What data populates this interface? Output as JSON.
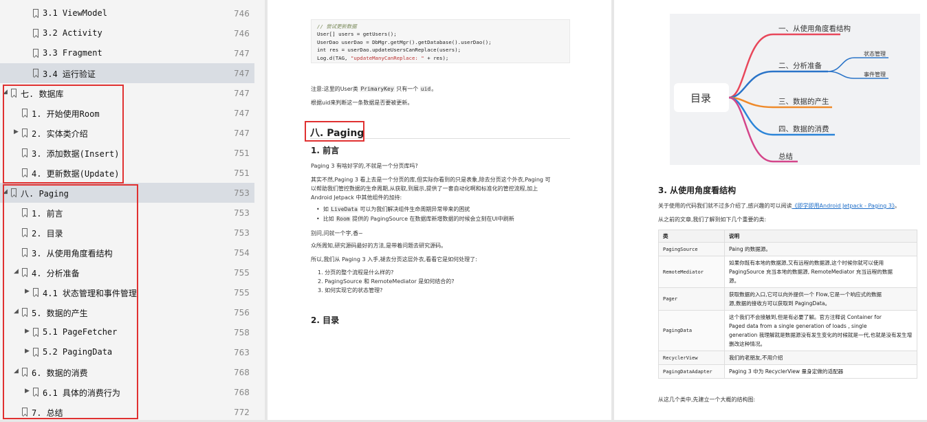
{
  "toc": [
    {
      "label": "3.1 ViewModel",
      "page": "746",
      "indent": 2,
      "arrow": "",
      "selected": false
    },
    {
      "label": "3.2 Activity",
      "page": "746",
      "indent": 2,
      "arrow": "",
      "selected": false
    },
    {
      "label": "3.3 Fragment",
      "page": "747",
      "indent": 2,
      "arrow": "",
      "selected": false
    },
    {
      "label": "3.4 运行验证",
      "page": "747",
      "indent": 2,
      "arrow": "",
      "selected": true
    },
    {
      "label": "七. 数据库",
      "page": "747",
      "indent": 0,
      "arrow": "down",
      "selected": false
    },
    {
      "label": "1. 开始使用Room",
      "page": "747",
      "indent": 1,
      "arrow": "",
      "selected": false
    },
    {
      "label": "2. 实体类介绍",
      "page": "747",
      "indent": 1,
      "arrow": "right",
      "selected": false
    },
    {
      "label": "3. 添加数据(Insert)",
      "page": "751",
      "indent": 1,
      "arrow": "",
      "selected": false
    },
    {
      "label": "4. 更新数据(Update)",
      "page": "751",
      "indent": 1,
      "arrow": "",
      "selected": false
    },
    {
      "label": "八. Paging",
      "page": "753",
      "indent": 0,
      "arrow": "down",
      "selected": true
    },
    {
      "label": "1. 前言",
      "page": "753",
      "indent": 1,
      "arrow": "",
      "selected": false
    },
    {
      "label": "2. 目录",
      "page": "753",
      "indent": 1,
      "arrow": "",
      "selected": false
    },
    {
      "label": "3. 从使用角度看结构",
      "page": "754",
      "indent": 1,
      "arrow": "",
      "selected": false
    },
    {
      "label": "4. 分析准备",
      "page": "755",
      "indent": 1,
      "arrow": "down",
      "selected": false
    },
    {
      "label": "4.1 状态管理和事件管理",
      "page": "755",
      "indent": 2,
      "arrow": "right",
      "selected": false
    },
    {
      "label": "5. 数据的产生",
      "page": "756",
      "indent": 1,
      "arrow": "down",
      "selected": false
    },
    {
      "label": "5.1 PageFetcher",
      "page": "758",
      "indent": 2,
      "arrow": "right",
      "selected": false
    },
    {
      "label": "5.2 PagingData",
      "page": "763",
      "indent": 2,
      "arrow": "right",
      "selected": false
    },
    {
      "label": "6. 数据的消费",
      "page": "768",
      "indent": 1,
      "arrow": "down",
      "selected": false
    },
    {
      "label": "6.1 具体的消费行为",
      "page": "768",
      "indent": 2,
      "arrow": "right",
      "selected": false
    },
    {
      "label": "7. 总结",
      "page": "772",
      "indent": 1,
      "arrow": "",
      "selected": false
    }
  ],
  "code": {
    "comment": "// 尝试更新数据",
    "line1": "User[] users = getUsers();",
    "line2": "UserDao userDao = DbMgr.getMgr().getDatabase().userDao();",
    "line3": "int res = userDao.updateUsersCanReplace(users);",
    "line4a": "Log.d(TAG, ",
    "line4b": "\"updateManyCanReplace: \"",
    "line4c": " + res);"
  },
  "page1": {
    "note_a": "注意:这里的User类 ",
    "note_code": "PrimaryKey",
    "note_b": " 只有一个 ",
    "note_code2": "uid",
    "note_c": "。",
    "note2": "根据uid来判断这一条数据是否要被更新。",
    "chapter": "八. Paging",
    "sec1": "1. 前言",
    "p1": "Paging 3 有啥好学的,不就是一个分页库吗?",
    "p2a": "其实不然,Paging 3 看上去是一个分页的库,但实际你看到的只是表象,除去分页这个外衣,Paging 可",
    "p2b": "以帮助我们管控数据的生命周期,从获取,到展示,提供了一套自动化啊和标准化的管控流程,加上",
    "p2c": "Android Jetpack 中其他组件的加持:",
    "b1a": "如 ",
    "b1code": "LiveData",
    "b1b": " 可以为我们解决组件生命周期异常带来的困扰",
    "b2a": "比如 ",
    "b2code": "Room",
    "b2b": " 提供的 PagingSource 在数据库新增数据的时候会立刻在UI中刷新",
    "p3": "别问,问就一个字,香~",
    "p4": "众所周知,研究源码最好的方法,是带着问题去研究源码。",
    "p5": "所以,我们从 Paging 3 入手,褪去分页这层外衣,看看它是如何处理了:",
    "q1": "1. 分页的整个流程是什么样的?",
    "q2": "2. PagingSource 和 RemoteMediator 是如何结合的?",
    "q3": "3. 如何实现它的状态管理?",
    "sec2": "2. 目录"
  },
  "mindmap": {
    "root": "目录",
    "b1": "一、从使用角度看结构",
    "b2": "二、分析准备",
    "b2a": "状态管理",
    "b2b": "事件管理",
    "b3": "三、数据的产生",
    "b4": "四、数据的消费",
    "b5": "总结",
    "colors": {
      "b1": "#e8475a",
      "b2": "#2a74c8",
      "b3": "#ef8a2a",
      "b4": "#2a84d8",
      "b5": "#d4458a"
    }
  },
  "page2": {
    "sec3": "3. 从使用角度看结构",
    "intro_a": "关于使用的代码我们就不过多介绍了,感兴趣的可以阅读",
    "intro_link": "《即学即用Android Jetpack - Paging 3》",
    "intro_b": "。",
    "intro2": "从之前的文章,我们了解到如下几个重要的类:",
    "th_k": "类",
    "th_v": "说明",
    "rows": [
      {
        "k": "PagingSource",
        "v1": "Paing 的数据源。",
        "v2": "",
        "v3": ""
      },
      {
        "k": "RemoteMediator",
        "v1": "如果你既有本地的数据源,又有远程的数据源,这个时候你就可以使用",
        "v2": "PagingSource 充当本地的数据源, RemoteMediator 充当远程的数据",
        "v3": "源。"
      },
      {
        "k": "Pager",
        "v1": "获取数据的入口,它可以向外提供一个 Flow,它是一个响应式的数据",
        "v2": "源,数据的接收方可以获取到 PagingData。",
        "v3": ""
      },
      {
        "k": "PagingData",
        "v1": "这个我们不会接触到,但是有必要了解。官方注释说 Container for",
        "v2": "Paged data from a single generation of loads , single",
        "v3": "generation 我理解就是数据源没有发生变化的时候就是一代,也就是没有发生增删改这种情况。"
      },
      {
        "k": "RecyclerView",
        "v1": "我们的老朋友,不用介绍",
        "v2": "",
        "v3": ""
      },
      {
        "k": "PagingDataAdapter",
        "v1": "Paging 3 中为 RecyclerView 量身定做的适配器",
        "v2": "",
        "v3": ""
      }
    ],
    "outro": "从这几个类中,先建立一个大概的结构图:"
  }
}
